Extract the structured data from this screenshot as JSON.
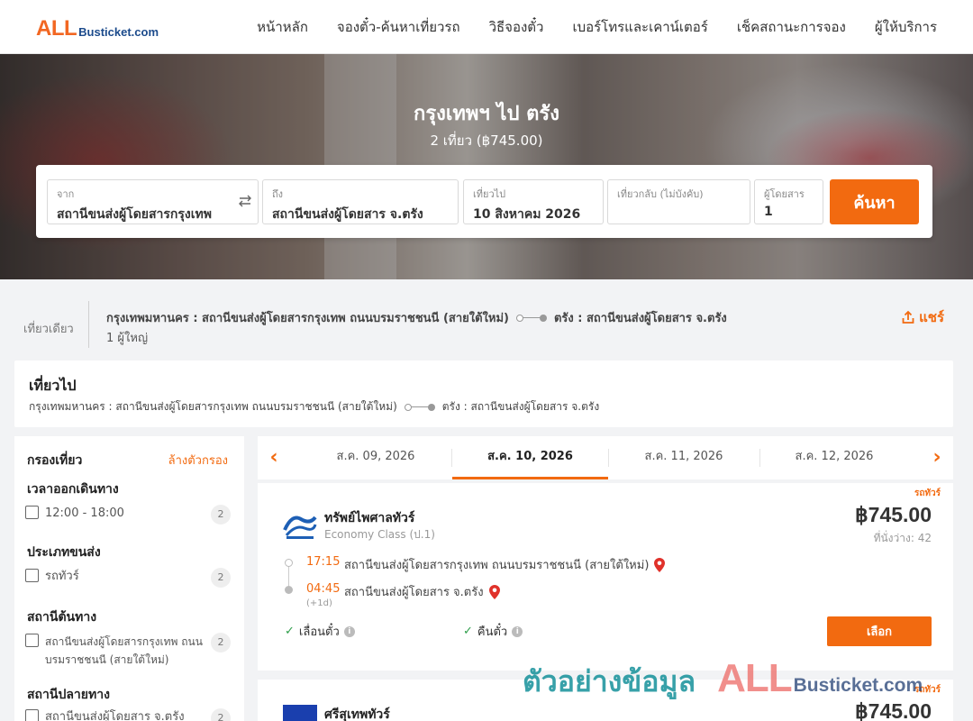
{
  "header": {
    "logo_all": "ALL",
    "logo_rest": "Busticket.com",
    "nav": [
      "หน้าหลัก",
      "จองตั๋ว-ค้นหาเที่ยวรถ",
      "วิธีจองตั๋ว",
      "เบอร์โทรและเคาน์เตอร์",
      "เช็คสถานะการจอง",
      "ผู้ให้บริการ"
    ]
  },
  "hero": {
    "title": "กรุงเทพฯ ไป ตรัง",
    "subtitle": "2 เที่ยว (฿745.00)"
  },
  "search": {
    "from_label": "จาก",
    "from_value": "สถานีขนส่งผู้โดยสารกรุงเทพ",
    "to_label": "ถึง",
    "to_value": "สถานีขนส่งผู้โดยสาร จ.ตรัง",
    "depart_label": "เที่ยวไป",
    "depart_value": "10 สิงหาคม 2026",
    "return_label": "เที่ยวกลับ (ไม่บังคับ)",
    "return_value": "",
    "pax_label": "ผู้โดยสาร",
    "pax_value": "1",
    "button": "ค้นหา"
  },
  "summary": {
    "trip_type": "เที่ยวเดียว",
    "from": "กรุงเทพมหานคร : สถานีขนส่งผู้โดยสารกรุงเทพ ถนนบรมราชชนนี (สายใต้ใหม่)",
    "to": "ตรัง : สถานีขนส่งผู้โดยสาร จ.ตรัง",
    "passengers": "1 ผู้ใหญ่",
    "share": "แชร์"
  },
  "outbound": {
    "title": "เที่ยวไป",
    "from": "กรุงเทพมหานคร : สถานีขนส่งผู้โดยสารกรุงเทพ ถนนบรมราชชนนี (สายใต้ใหม่)",
    "to": "ตรัง : สถานีขนส่งผู้โดยสาร จ.ตรัง"
  },
  "filters": {
    "title": "กรองเที่ยว",
    "clear": "ล้างตัวกรอง",
    "groups": [
      {
        "title": "เวลาออกเดินทาง",
        "options": [
          {
            "label": "12:00 - 18:00",
            "count": "2"
          }
        ]
      },
      {
        "title": "ประเภทขนส่ง",
        "options": [
          {
            "label": "รถทัวร์",
            "count": "2"
          }
        ]
      },
      {
        "title": "สถานีต้นทาง",
        "options": [
          {
            "label": "สถานีขนส่งผู้โดยสารกรุงเทพ ถนนบรมราชชนนี (สายใต้ใหม่)",
            "count": "2"
          }
        ]
      },
      {
        "title": "สถานีปลายทาง",
        "options": [
          {
            "label": "สถานีขนส่งผู้โดยสาร จ.ตรัง",
            "count": "2"
          }
        ]
      }
    ]
  },
  "date_tabs": [
    {
      "label": "ส.ค. 09, 2026",
      "active": false
    },
    {
      "label": "ส.ค. 10, 2026",
      "active": true
    },
    {
      "label": "ส.ค. 11, 2026",
      "active": false
    },
    {
      "label": "ส.ค. 12, 2026",
      "active": false
    }
  ],
  "trips": [
    {
      "tag": "รถทัวร์",
      "operator": "ทรัพย์ไพศาลทัวร์",
      "class": "Economy Class (ป.1)",
      "price": "฿745.00",
      "seats": "ที่นั่งว่าง: 42",
      "depart_time": "17:15",
      "depart_station": "สถานีขนส่งผู้โดยสารกรุงเทพ ถนนบรมราชชนนี (สายใต้ใหม่)",
      "arrive_time": "04:45",
      "arrive_station": "สถานีขนส่งผู้โดยสาร จ.ตรัง",
      "day_offset": "(+1d)",
      "feature_1": "เลื่อนตั๋ว",
      "feature_2": "คืนตั๋ว",
      "button": "เลือก"
    },
    {
      "tag": "รถทัวร์",
      "operator": "ศรีสุเทพทัวร์",
      "price": "฿745.00"
    }
  ],
  "watermark": {
    "thai": "ตัวอย่างข้อมูล",
    "all": "ALL",
    "rest": "Busticket.com"
  },
  "colors": {
    "accent": "#f26a10",
    "logo_orange": "#f26722",
    "logo_blue": "#1c4b8c",
    "check_green": "#2e9e4a"
  }
}
